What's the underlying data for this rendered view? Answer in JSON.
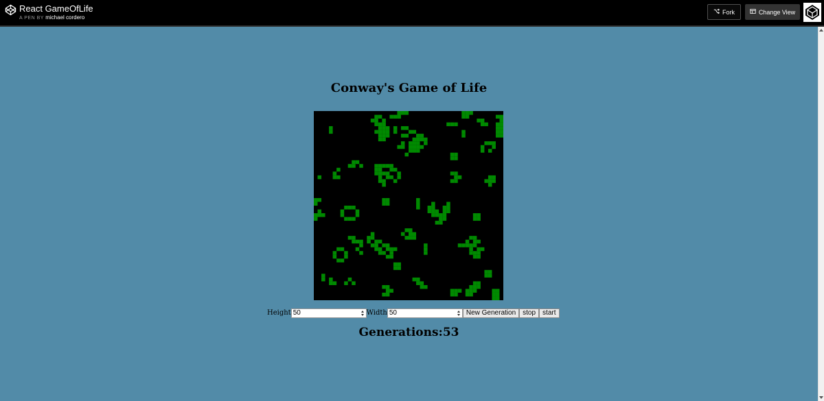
{
  "header": {
    "title": "React GameOfLife",
    "by_label": "A PEN BY",
    "author": "michael cordero",
    "fork_label": "Fork",
    "change_view_label": "Change View"
  },
  "main": {
    "title": "Conway's Game of Life",
    "height_label": "Height",
    "height_value": "50",
    "width_label": "Width",
    "width_value": "50",
    "new_generation_label": "New Generation",
    "stop_label": "stop",
    "start_label": "start",
    "generations_text": "Generations:53"
  },
  "board": {
    "rows": 50,
    "cols": 50,
    "cell_color": "#008a00",
    "background_color": "#000000",
    "live_cells": [
      [
        0,
        22
      ],
      [
        0,
        23
      ],
      [
        0,
        24
      ],
      [
        0,
        39
      ],
      [
        0,
        40
      ],
      [
        0,
        41
      ],
      [
        1,
        16
      ],
      [
        1,
        17
      ],
      [
        1,
        20
      ],
      [
        1,
        21
      ],
      [
        1,
        22
      ],
      [
        1,
        39
      ],
      [
        1,
        40
      ],
      [
        1,
        48
      ],
      [
        1,
        49
      ],
      [
        2,
        15
      ],
      [
        2,
        16
      ],
      [
        2,
        18
      ],
      [
        2,
        43
      ],
      [
        2,
        44
      ],
      [
        2,
        49
      ],
      [
        3,
        16
      ],
      [
        3,
        17
      ],
      [
        3,
        18
      ],
      [
        3,
        35
      ],
      [
        3,
        36
      ],
      [
        3,
        37
      ],
      [
        3,
        44
      ],
      [
        3,
        45
      ],
      [
        3,
        48
      ],
      [
        3,
        49
      ],
      [
        4,
        4
      ],
      [
        4,
        17
      ],
      [
        4,
        18
      ],
      [
        4,
        19
      ],
      [
        4,
        21
      ],
      [
        4,
        23
      ],
      [
        4,
        24
      ],
      [
        4,
        48
      ],
      [
        4,
        49
      ],
      [
        5,
        4
      ],
      [
        5,
        16
      ],
      [
        5,
        17
      ],
      [
        5,
        18
      ],
      [
        5,
        19
      ],
      [
        5,
        21
      ],
      [
        5,
        25
      ],
      [
        5,
        26
      ],
      [
        5,
        39
      ],
      [
        5,
        48
      ],
      [
        5,
        49
      ],
      [
        6,
        17
      ],
      [
        6,
        18
      ],
      [
        6,
        19
      ],
      [
        6,
        23
      ],
      [
        6,
        24
      ],
      [
        6,
        27
      ],
      [
        6,
        28
      ],
      [
        6,
        39
      ],
      [
        6,
        48
      ],
      [
        6,
        49
      ],
      [
        7,
        17
      ],
      [
        7,
        18
      ],
      [
        7,
        26
      ],
      [
        7,
        27
      ],
      [
        7,
        28
      ],
      [
        7,
        29
      ],
      [
        8,
        23
      ],
      [
        8,
        25
      ],
      [
        8,
        26
      ],
      [
        8,
        27
      ],
      [
        8,
        29
      ],
      [
        8,
        45
      ],
      [
        8,
        46
      ],
      [
        8,
        47
      ],
      [
        9,
        22
      ],
      [
        9,
        23
      ],
      [
        9,
        25
      ],
      [
        9,
        26
      ],
      [
        9,
        27
      ],
      [
        9,
        28
      ],
      [
        9,
        44
      ],
      [
        9,
        47
      ],
      [
        10,
        25
      ],
      [
        10,
        26
      ],
      [
        10,
        27
      ],
      [
        10,
        44
      ],
      [
        10,
        46
      ],
      [
        11,
        24
      ],
      [
        11,
        36
      ],
      [
        11,
        37
      ],
      [
        12,
        36
      ],
      [
        12,
        37
      ],
      [
        13,
        10
      ],
      [
        13,
        11
      ],
      [
        14,
        9
      ],
      [
        14,
        10
      ],
      [
        14,
        12
      ],
      [
        14,
        16
      ],
      [
        14,
        17
      ],
      [
        14,
        18
      ],
      [
        14,
        19
      ],
      [
        14,
        20
      ],
      [
        15,
        6
      ],
      [
        15,
        16
      ],
      [
        15,
        17
      ],
      [
        15,
        20
      ],
      [
        15,
        21
      ],
      [
        16,
        5
      ],
      [
        16,
        16
      ],
      [
        16,
        17
      ],
      [
        16,
        18
      ],
      [
        16,
        19
      ],
      [
        16,
        22
      ],
      [
        16,
        36
      ],
      [
        16,
        37
      ],
      [
        17,
        1
      ],
      [
        17,
        5
      ],
      [
        17,
        6
      ],
      [
        17,
        17
      ],
      [
        17,
        19
      ],
      [
        17,
        20
      ],
      [
        17,
        22
      ],
      [
        17,
        37
      ],
      [
        17,
        38
      ],
      [
        17,
        46
      ],
      [
        17,
        47
      ],
      [
        18,
        17
      ],
      [
        18,
        18
      ],
      [
        18,
        21
      ],
      [
        18,
        36
      ],
      [
        18,
        37
      ],
      [
        18,
        45
      ],
      [
        18,
        46
      ],
      [
        18,
        47
      ],
      [
        19,
        18
      ],
      [
        19,
        46
      ],
      [
        23,
        0
      ],
      [
        23,
        1
      ],
      [
        23,
        18
      ],
      [
        23,
        19
      ],
      [
        23,
        27
      ],
      [
        24,
        0
      ],
      [
        24,
        18
      ],
      [
        24,
        19
      ],
      [
        24,
        27
      ],
      [
        24,
        31
      ],
      [
        24,
        35
      ],
      [
        25,
        8
      ],
      [
        25,
        9
      ],
      [
        25,
        10
      ],
      [
        25,
        27
      ],
      [
        25,
        30
      ],
      [
        25,
        31
      ],
      [
        25,
        34
      ],
      [
        25,
        35
      ],
      [
        26,
        1
      ],
      [
        26,
        7
      ],
      [
        26,
        11
      ],
      [
        26,
        30
      ],
      [
        26,
        31
      ],
      [
        26,
        32
      ],
      [
        26,
        34
      ],
      [
        26,
        35
      ],
      [
        27,
        0
      ],
      [
        27,
        1
      ],
      [
        27,
        2
      ],
      [
        27,
        7
      ],
      [
        27,
        11
      ],
      [
        27,
        31
      ],
      [
        27,
        32
      ],
      [
        27,
        33
      ],
      [
        27,
        34
      ],
      [
        27,
        42
      ],
      [
        27,
        43
      ],
      [
        28,
        0
      ],
      [
        28,
        8
      ],
      [
        28,
        9
      ],
      [
        28,
        10
      ],
      [
        28,
        33
      ],
      [
        28,
        34
      ],
      [
        28,
        42
      ],
      [
        28,
        43
      ],
      [
        29,
        32
      ],
      [
        29,
        33
      ],
      [
        31,
        24
      ],
      [
        31,
        25
      ],
      [
        32,
        15
      ],
      [
        32,
        23
      ],
      [
        32,
        25
      ],
      [
        32,
        26
      ],
      [
        33,
        9
      ],
      [
        33,
        10
      ],
      [
        33,
        14
      ],
      [
        33,
        15
      ],
      [
        33,
        24
      ],
      [
        33,
        25
      ],
      [
        33,
        26
      ],
      [
        33,
        41
      ],
      [
        33,
        42
      ],
      [
        34,
        10
      ],
      [
        34,
        11
      ],
      [
        34,
        12
      ],
      [
        34,
        14
      ],
      [
        34,
        16
      ],
      [
        34,
        17
      ],
      [
        34,
        40
      ],
      [
        34,
        42
      ],
      [
        34,
        43
      ],
      [
        35,
        12
      ],
      [
        35,
        15
      ],
      [
        35,
        16
      ],
      [
        35,
        18
      ],
      [
        35,
        19
      ],
      [
        35,
        29
      ],
      [
        35,
        38
      ],
      [
        35,
        39
      ],
      [
        35,
        40
      ],
      [
        35,
        41
      ],
      [
        35,
        42
      ],
      [
        36,
        6
      ],
      [
        36,
        7
      ],
      [
        36,
        11
      ],
      [
        36,
        16
      ],
      [
        36,
        17
      ],
      [
        36,
        19
      ],
      [
        36,
        20
      ],
      [
        36,
        21
      ],
      [
        36,
        29
      ],
      [
        36,
        41
      ],
      [
        36,
        43
      ],
      [
        36,
        44
      ],
      [
        37,
        5
      ],
      [
        37,
        8
      ],
      [
        37,
        12
      ],
      [
        37,
        17
      ],
      [
        37,
        18
      ],
      [
        37,
        20
      ],
      [
        37,
        29
      ],
      [
        37,
        41
      ],
      [
        37,
        42
      ],
      [
        37,
        43
      ],
      [
        38,
        5
      ],
      [
        38,
        8
      ],
      [
        38,
        19
      ],
      [
        38,
        20
      ],
      [
        38,
        42
      ],
      [
        38,
        43
      ],
      [
        39,
        6
      ],
      [
        39,
        7
      ],
      [
        40,
        21
      ],
      [
        40,
        22
      ],
      [
        41,
        21
      ],
      [
        41,
        22
      ],
      [
        42,
        45
      ],
      [
        42,
        46
      ],
      [
        43,
        2
      ],
      [
        43,
        45
      ],
      [
        43,
        46
      ],
      [
        44,
        2
      ],
      [
        44,
        4
      ],
      [
        44,
        9
      ],
      [
        44,
        26
      ],
      [
        44,
        27
      ],
      [
        45,
        4
      ],
      [
        45,
        5
      ],
      [
        45,
        8
      ],
      [
        45,
        10
      ],
      [
        45,
        27
      ],
      [
        45,
        28
      ],
      [
        45,
        42
      ],
      [
        45,
        43
      ],
      [
        46,
        18
      ],
      [
        46,
        19
      ],
      [
        46,
        28
      ],
      [
        46,
        29
      ],
      [
        46,
        41
      ],
      [
        46,
        42
      ],
      [
        46,
        43
      ],
      [
        47,
        19
      ],
      [
        47,
        20
      ],
      [
        47,
        36
      ],
      [
        47,
        37
      ],
      [
        47,
        38
      ],
      [
        47,
        40
      ],
      [
        47,
        41
      ],
      [
        47,
        42
      ],
      [
        47,
        47
      ],
      [
        47,
        48
      ],
      [
        48,
        18
      ],
      [
        48,
        19
      ],
      [
        48,
        36
      ],
      [
        48,
        37
      ],
      [
        48,
        40
      ],
      [
        48,
        41
      ],
      [
        48,
        47
      ],
      [
        48,
        48
      ],
      [
        49,
        47
      ],
      [
        49,
        48
      ]
    ]
  },
  "icons": {
    "logo": "codepen-logo-icon",
    "fork": "fork-icon",
    "change_view": "layout-icon",
    "badge": "codepen-cube-icon"
  }
}
